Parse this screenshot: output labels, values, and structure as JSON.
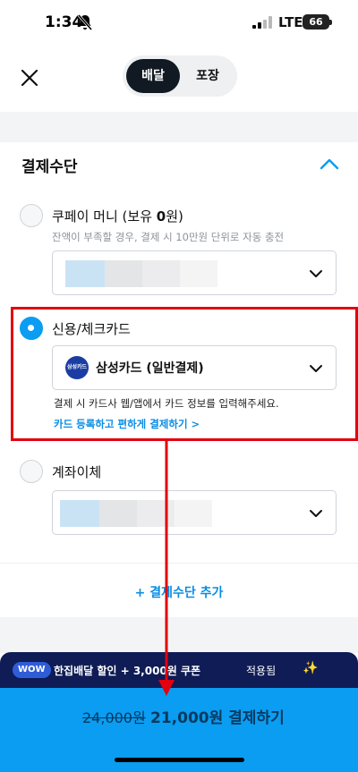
{
  "status_bar": {
    "time": "1:34",
    "network": "LTE",
    "battery": "66"
  },
  "header": {
    "tabs": [
      {
        "label": "배달",
        "active": true
      },
      {
        "label": "포장",
        "active": false
      }
    ]
  },
  "payment": {
    "section_title": "결제수단",
    "options": [
      {
        "label_prefix": "쿠페이 머니 (보유 ",
        "label_amount": "0",
        "label_suffix": "원)",
        "hint": "잔액이 부족할 경우, 결제 시 10만원 단위로 자동 충전",
        "selected": false
      },
      {
        "label": "신용/체크카드",
        "selected": true,
        "card_logo": "삼성카드",
        "card_name": "삼성카드 (일반결제)",
        "info": "결제 시 카드사 웹/앱에서 카드 정보를 입력해주세요.",
        "link": "카드 등록하고 편하게 결제하기 >"
      },
      {
        "label": "계좌이체",
        "selected": false
      }
    ],
    "add_method": "+ 결제수단 추가"
  },
  "promo": {
    "badge": "WOW",
    "text": "한집배달 할인 + 3,000원 쿠폰",
    "suffix": "적용됨",
    "sparkle": "✨"
  },
  "pay_button": {
    "original_price": "24,000원",
    "label": "21,000원 결제하기"
  },
  "colors": {
    "accent": "#0a9df2",
    "promo_bg": "#0f1c55",
    "highlight": "#e3000f",
    "link": "#0a8de4"
  }
}
